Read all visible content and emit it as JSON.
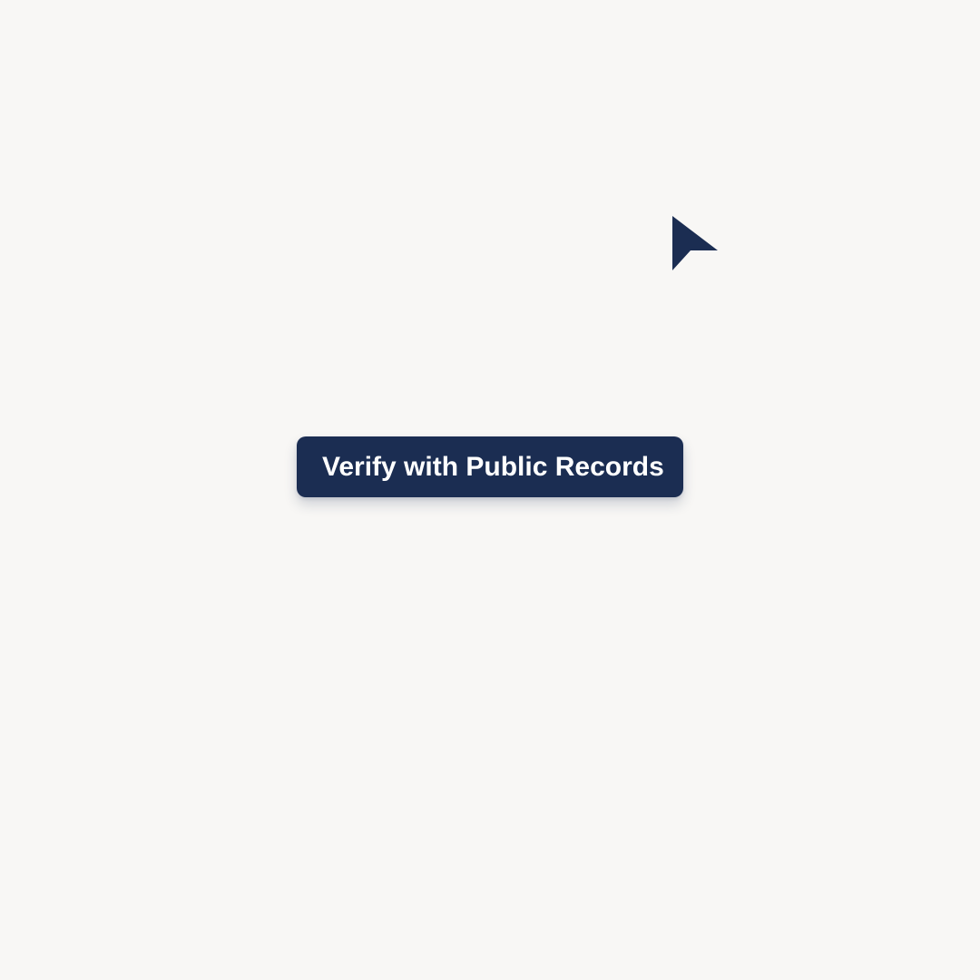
{
  "background_color": "#f8f7f5",
  "accent_color": "#1b2d52",
  "cta": {
    "label": "Verify with Public Records"
  },
  "cursor": {
    "icon": "mouse-pointer-icon"
  }
}
